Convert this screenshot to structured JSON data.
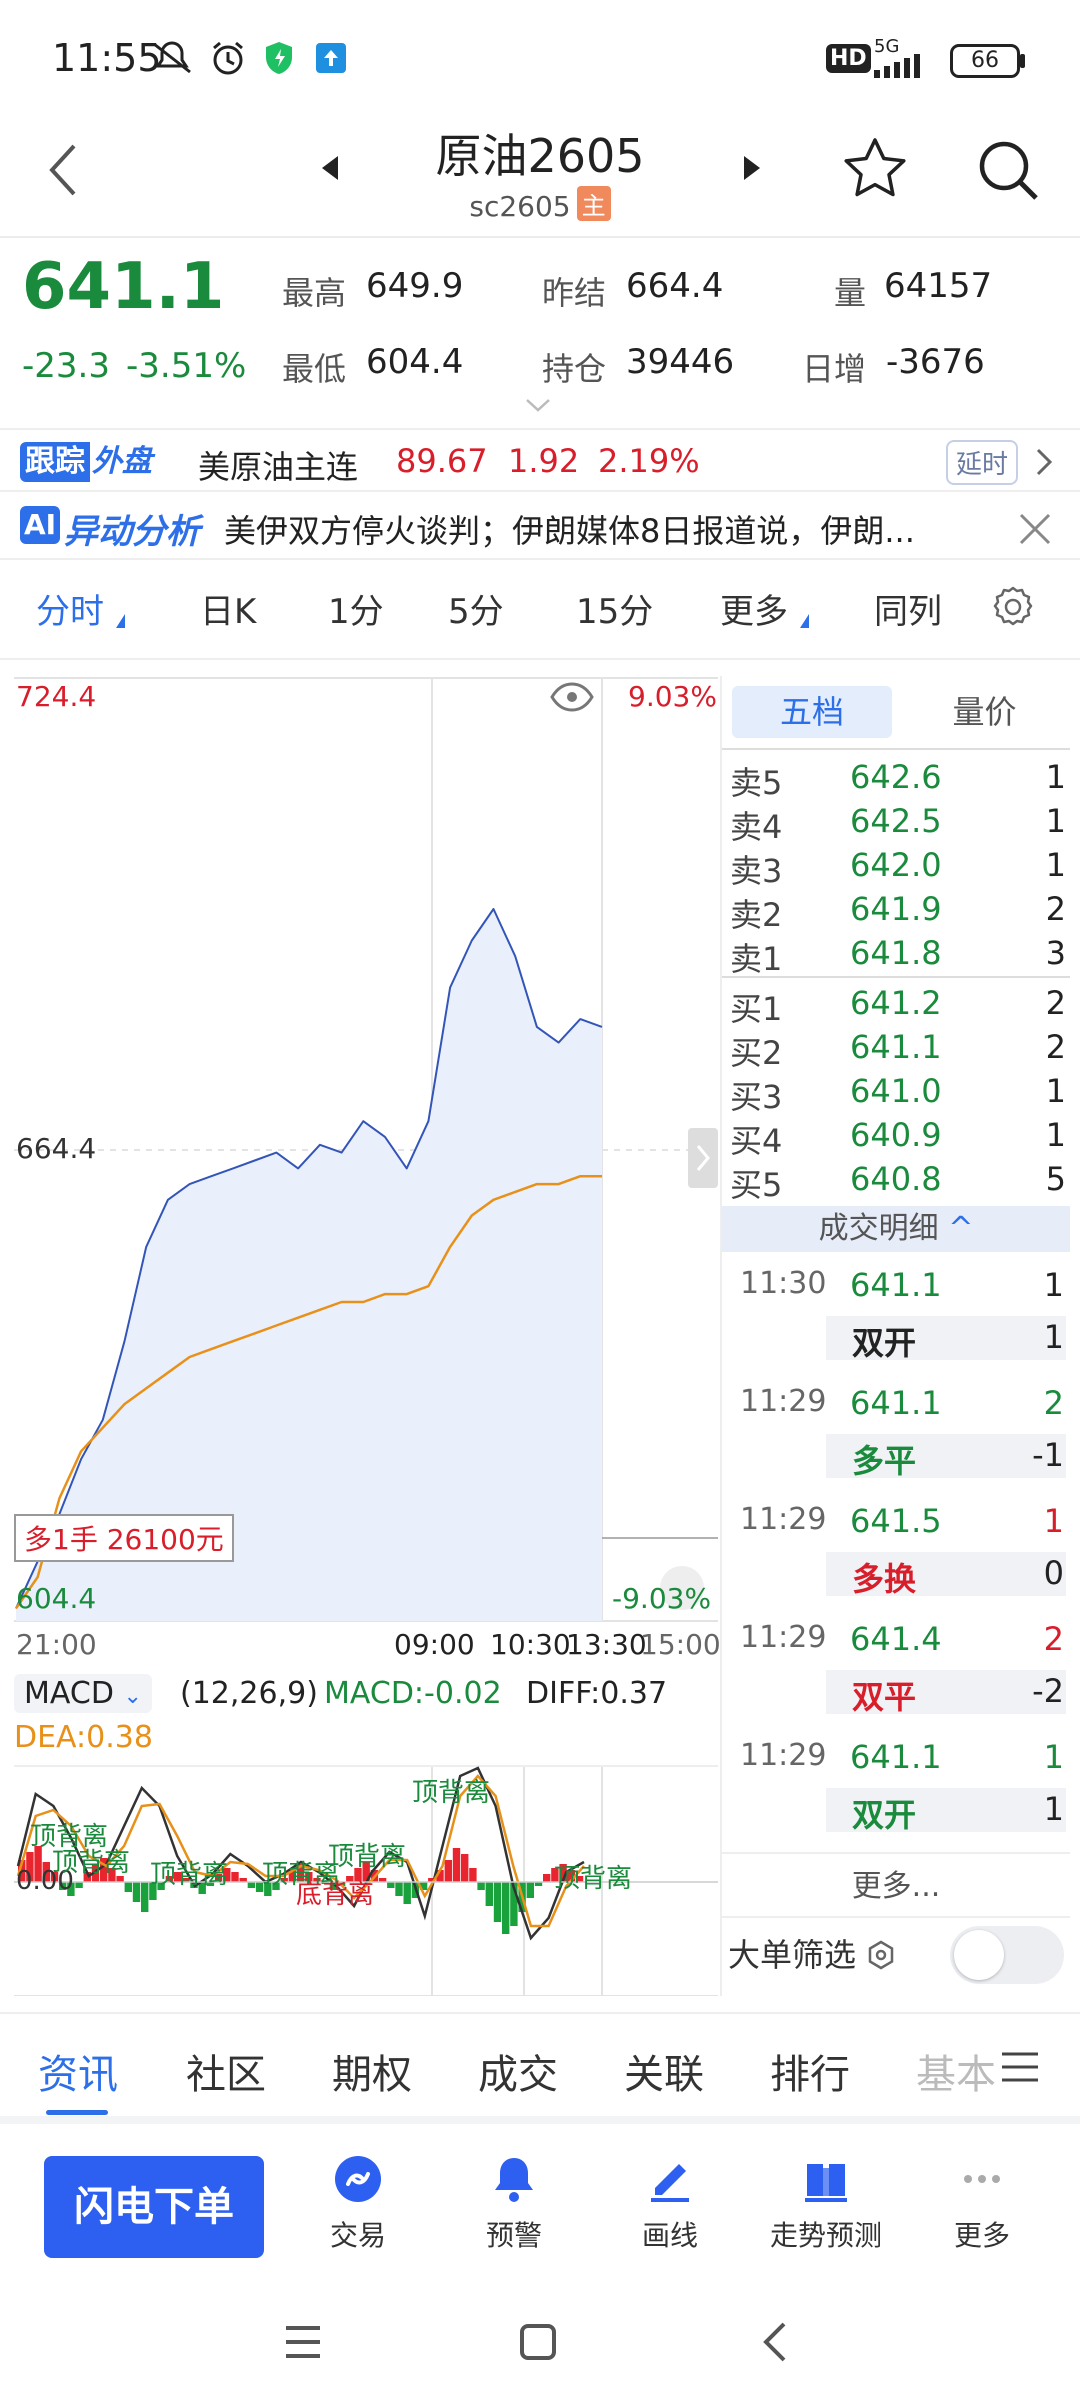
{
  "status_bar": {
    "time": "11:55",
    "battery": "66",
    "network": "5G",
    "hd": "HD"
  },
  "header": {
    "title": "原油2605",
    "subtitle": "sc2605",
    "main_badge": "主"
  },
  "quote": {
    "last_price": "641.1",
    "change_abs": "-23.3",
    "change_pct": "-3.51%",
    "high_label": "最高",
    "high": "649.9",
    "low_label": "最低",
    "low": "604.4",
    "prev_settle_label": "昨结",
    "prev_settle": "664.4",
    "open_interest_label": "持仓",
    "open_interest": "39446",
    "volume_label": "量",
    "volume": "64157",
    "daily_change_label": "日增",
    "daily_change": "-3676"
  },
  "foreign": {
    "badge_1": "跟踪",
    "badge_2": "外盘",
    "name": "美原油主连",
    "price": "89.67",
    "change": "1.92",
    "pct": "2.19%",
    "delay_label": "延时"
  },
  "ai": {
    "badge": "AI",
    "title": "异动分析",
    "text": "美伊双方停火谈判；伊朗媒体8日报道说，伊朗..."
  },
  "chart_tabs": [
    "分时",
    "日K",
    "1分",
    "5分",
    "15分",
    "更多",
    "同列"
  ],
  "chart": {
    "y_top": "724.4",
    "y_mid": "664.4",
    "y_bottom": "604.4",
    "pct_top": "9.03%",
    "pct_bottom": "-9.03%",
    "x_labels": [
      "21:00",
      "09:00",
      "10:30",
      "13:30",
      "15:00"
    ],
    "position_box": "多1手  26100元",
    "macd_indicator": "MACD",
    "macd_params": "(12,26,9)",
    "macd_value": "MACD:-0.02",
    "diff_value": "DIFF:0.37",
    "dea_value": "DEA:0.38",
    "macd_zero": "0.00",
    "divergence_labels": {
      "top": "顶背离",
      "bottom": "底背离"
    },
    "colors": {
      "price_line": "#3355b8",
      "avg_line": "#e8911a",
      "up": "#e8242f",
      "down": "#19a13b"
    }
  },
  "chart_data": {
    "type": "line",
    "ylim": [
      604.4,
      724.4
    ],
    "series": [
      {
        "values": [
          606,
          612,
          618,
          625,
          630,
          640,
          652,
          658,
          660,
          661,
          662,
          663,
          664,
          662,
          665,
          664,
          668,
          666,
          662,
          668,
          685,
          691,
          695,
          689,
          680,
          678,
          681,
          680
        ]
      },
      {
        "values": [
          606,
          610,
          620,
          626,
          629,
          632,
          634,
          636,
          638,
          639,
          640,
          641,
          642,
          643,
          644,
          645,
          645,
          646,
          646,
          647,
          652,
          656,
          658,
          659,
          660,
          660,
          661,
          661
        ]
      }
    ]
  },
  "book": {
    "tab_1": "五档",
    "tab_2": "量价",
    "asks": [
      {
        "label": "卖5",
        "price": "642.6",
        "qty": "1"
      },
      {
        "label": "卖4",
        "price": "642.5",
        "qty": "1"
      },
      {
        "label": "卖3",
        "price": "642.0",
        "qty": "1"
      },
      {
        "label": "卖2",
        "price": "641.9",
        "qty": "2"
      },
      {
        "label": "卖1",
        "price": "641.8",
        "qty": "3"
      }
    ],
    "bids": [
      {
        "label": "买1",
        "price": "641.2",
        "qty": "2"
      },
      {
        "label": "买2",
        "price": "641.1",
        "qty": "2"
      },
      {
        "label": "买3",
        "price": "641.0",
        "qty": "1"
      },
      {
        "label": "买4",
        "price": "640.9",
        "qty": "1"
      },
      {
        "label": "买5",
        "price": "640.8",
        "qty": "5"
      }
    ],
    "trades_header": "成交明细",
    "trades": [
      {
        "time": "11:30",
        "price": "641.1",
        "qty": "1",
        "qty_color": "#222222",
        "kind": "双开",
        "kind_color": "#222222",
        "oi": "1"
      },
      {
        "time": "11:29",
        "price": "641.1",
        "qty": "2",
        "qty_color": "#1a8a3c",
        "kind": "多平",
        "kind_color": "#1a8a3c",
        "oi": "-1"
      },
      {
        "time": "11:29",
        "price": "641.5",
        "qty": "1",
        "qty_color": "#d81e2a",
        "kind": "多换",
        "kind_color": "#d81e2a",
        "oi": "0"
      },
      {
        "time": "11:29",
        "price": "641.4",
        "qty": "2",
        "qty_color": "#d81e2a",
        "kind": "双平",
        "kind_color": "#d81e2a",
        "oi": "-2"
      },
      {
        "time": "11:29",
        "price": "641.1",
        "qty": "1",
        "qty_color": "#1a8a3c",
        "kind": "双开",
        "kind_color": "#1a8a3c",
        "oi": "1"
      }
    ],
    "more_label": "更多...",
    "big_order_label": "大单筛选"
  },
  "bottom_tabs": [
    "资讯",
    "社区",
    "期权",
    "成交",
    "关联",
    "排行",
    "基本"
  ],
  "actions": {
    "flash_order": "闪电下单",
    "items": [
      "交易",
      "预警",
      "画线",
      "走势预测",
      "更多"
    ]
  }
}
